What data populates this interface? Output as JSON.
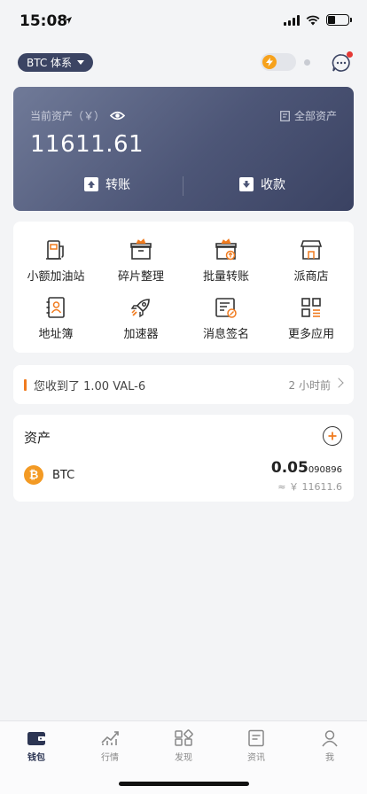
{
  "status_bar": {
    "time": "15:08"
  },
  "header": {
    "system_label": "BTC 体系"
  },
  "asset_card": {
    "label": "当前资产（￥）",
    "all_assets_label": "全部资产",
    "amount": "11611.61",
    "transfer_label": "转账",
    "receive_label": "收款"
  },
  "tools": [
    {
      "label": "小额加油站",
      "icon": "gas-station-icon"
    },
    {
      "label": "碎片整理",
      "icon": "box-icon"
    },
    {
      "label": "批量转账",
      "icon": "batch-transfer-icon"
    },
    {
      "label": "派商店",
      "icon": "store-icon"
    },
    {
      "label": "地址簿",
      "icon": "address-book-icon"
    },
    {
      "label": "加速器",
      "icon": "rocket-icon"
    },
    {
      "label": "消息签名",
      "icon": "sign-message-icon"
    },
    {
      "label": "更多应用",
      "icon": "more-apps-icon"
    }
  ],
  "notice": {
    "text": "您收到了 1.00 VAL-6",
    "time": "2 小时前"
  },
  "assets": {
    "title": "资产",
    "items": [
      {
        "symbol": "BTC",
        "balance_main": "0.05",
        "balance_tail": "090896",
        "fiat": "≈ ￥ 11611.6"
      }
    ]
  },
  "tab_bar": [
    {
      "label": "钱包",
      "icon": "wallet-icon",
      "active": true
    },
    {
      "label": "行情",
      "icon": "market-icon",
      "active": false
    },
    {
      "label": "发现",
      "icon": "discover-icon",
      "active": false
    },
    {
      "label": "资讯",
      "icon": "news-icon",
      "active": false
    },
    {
      "label": "我",
      "icon": "profile-icon",
      "active": false
    }
  ],
  "colors": {
    "accent": "#3b4463",
    "card_start": "#707a98",
    "card_end": "#3a4262",
    "orange": "#f07b1f",
    "btc": "#f39a24"
  }
}
